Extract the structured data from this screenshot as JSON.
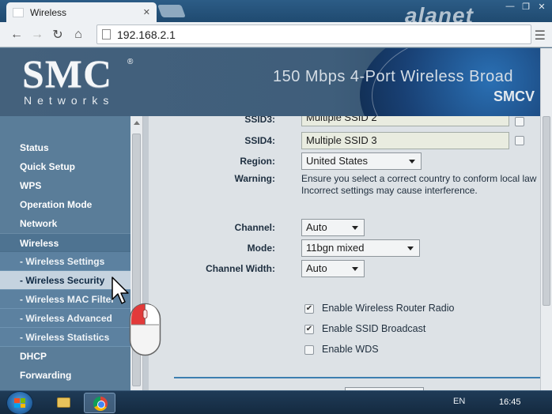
{
  "browser": {
    "tab_title": "Wireless",
    "tab_close": "✕",
    "url": "192.168.2.1",
    "watermark": "alanet",
    "window_controls": [
      "—",
      "❐",
      "✕"
    ]
  },
  "header": {
    "logo_main": "SMC",
    "logo_reg": "®",
    "logo_sub": "Networks",
    "product_title": "150 Mbps 4-Port Wireless Broad",
    "product_model": "SMCV"
  },
  "nav": {
    "items": [
      {
        "label": "Status",
        "kind": "top"
      },
      {
        "label": "Quick Setup",
        "kind": "top"
      },
      {
        "label": "WPS",
        "kind": "top"
      },
      {
        "label": "Operation Mode",
        "kind": "top"
      },
      {
        "label": "Network",
        "kind": "top"
      },
      {
        "label": "Wireless",
        "kind": "group"
      },
      {
        "label": "- Wireless Settings",
        "kind": "sub"
      },
      {
        "label": "- Wireless Security",
        "kind": "sub-active"
      },
      {
        "label": "- Wireless MAC Filter",
        "kind": "sub"
      },
      {
        "label": "- Wireless Advanced",
        "kind": "sub"
      },
      {
        "label": "- Wireless Statistics",
        "kind": "sub"
      },
      {
        "label": "DHCP",
        "kind": "top"
      },
      {
        "label": "Forwarding",
        "kind": "top"
      }
    ]
  },
  "form": {
    "ssid3_label": "SSID3:",
    "ssid3_value": "Multiple SSID 2",
    "ssid4_label": "SSID4:",
    "ssid4_value": "Multiple SSID 3",
    "region_label": "Region:",
    "region_value": "United States",
    "warning_label": "Warning:",
    "warning_line1": "Ensure you select a correct country to conform local law",
    "warning_line2": "Incorrect settings may cause interference.",
    "channel_label": "Channel:",
    "channel_value": "Auto",
    "mode_label": "Mode:",
    "mode_value": "11bgn mixed",
    "width_label": "Channel Width:",
    "width_value": "Auto",
    "enable_radio_label": "Enable Wireless Router Radio",
    "enable_radio_checked": true,
    "enable_ssid_label": "Enable SSID Broadcast",
    "enable_ssid_checked": true,
    "enable_wds_label": "Enable WDS",
    "enable_wds_checked": false,
    "check_mark": "✔"
  },
  "taskbar": {
    "language": "EN",
    "clock": "16:45"
  }
}
